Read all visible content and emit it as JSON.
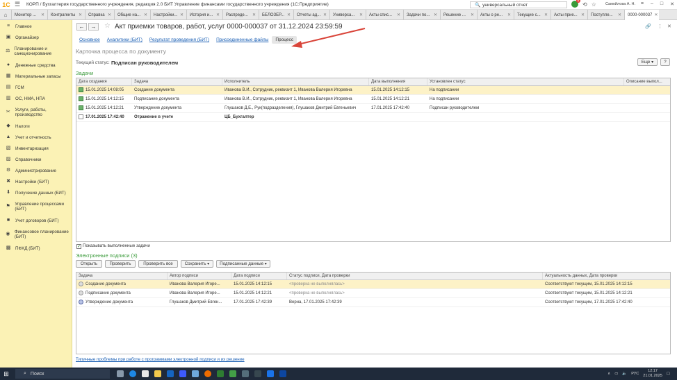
{
  "window": {
    "logo": "1С",
    "title": "КОРП / Бухгалтерия государственного учреждения, редакция 2.0 БИТ Управление финансами государственного учреждения (1С:Предприятие)",
    "search_value": "универсальный отчет",
    "user": "Самойлова А. Н."
  },
  "tabs": [
    {
      "label": "Монитор ..."
    },
    {
      "label": "Контрагенты"
    },
    {
      "label": "Справка"
    },
    {
      "label": "Общие на..."
    },
    {
      "label": "Настройки..."
    },
    {
      "label": "История и..."
    },
    {
      "label": "Распреде..."
    },
    {
      "label": "БЕЛОЗЕР..."
    },
    {
      "label": "Отчеты ад..."
    },
    {
      "label": "Универса..."
    },
    {
      "label": "Акты спис..."
    },
    {
      "label": "Задачи по..."
    },
    {
      "label": "Решение ..."
    },
    {
      "label": "Акты о ре..."
    },
    {
      "label": "Текущие с..."
    },
    {
      "label": "Акты прие..."
    },
    {
      "label": "Поступле..."
    },
    {
      "label": "0000-000037"
    }
  ],
  "sidebar": {
    "items": [
      {
        "label": "Главное",
        "icon": "menu-icon"
      },
      {
        "label": "Органайзер",
        "icon": "organizer-icon"
      },
      {
        "label": "Планирование и санкционирование",
        "icon": "planning-icon"
      },
      {
        "label": "Денежные средства",
        "icon": "money-icon"
      },
      {
        "label": "Материальные запасы",
        "icon": "materials-icon"
      },
      {
        "label": "ГСМ",
        "icon": "fuel-icon"
      },
      {
        "label": "ОС, НМА, НПА",
        "icon": "assets-icon"
      },
      {
        "label": "Услуги, работы, производство",
        "icon": "services-icon"
      },
      {
        "label": "Налоги",
        "icon": "taxes-icon"
      },
      {
        "label": "Учет и отчетность",
        "icon": "accounting-icon"
      },
      {
        "label": "Инвентаризация",
        "icon": "inventory-icon"
      },
      {
        "label": "Справочники",
        "icon": "reference-icon"
      },
      {
        "label": "Администрирование",
        "icon": "admin-icon"
      },
      {
        "label": "Настройки (БИТ)",
        "icon": "settings-icon"
      },
      {
        "label": "Получение данных (БИТ)",
        "icon": "download-icon"
      },
      {
        "label": "Управление процессами (БИТ)",
        "icon": "process-icon"
      },
      {
        "label": "Учет договоров (БИТ)",
        "icon": "contracts-icon"
      },
      {
        "label": "Финансовое планирование (БИТ)",
        "icon": "finance-icon"
      },
      {
        "label": "ПФХД (БИТ)",
        "icon": "pfhd-icon"
      }
    ]
  },
  "document": {
    "title": "Акт приемки товаров, работ, услуг 0000-000037 от 31.12.2024 23:59:59",
    "subtabs": [
      {
        "label": "Основное"
      },
      {
        "label": "Аналитики (БИТ)"
      },
      {
        "label": "Результат проведения (БИТ)"
      },
      {
        "label": "Присоединенные файлы"
      },
      {
        "label": "Процесс"
      }
    ],
    "card_title": "Карточка процесса по документу",
    "status_label": "Текущий статус:",
    "status_value": "Подписан руководителем",
    "more_button": "Еще",
    "help_button": "?"
  },
  "tasks": {
    "title": "Задачи",
    "columns": [
      "Дата создания",
      "Задача",
      "Исполнитель",
      "Дата выполнения",
      "Установлен статус",
      "Описание выпол..."
    ],
    "rows": [
      {
        "created": "15.01.2025 14:08:05",
        "task": "Создание документа",
        "executor": "Иванова В.И., Сотрудник, реквизит 1, Иванова Валерия Игоревна",
        "done": "15.01.2025 14:12:15",
        "status": "На подписании",
        "desc": ""
      },
      {
        "created": "15.01.2025 14:12:15",
        "task": "Подписание документа",
        "executor": "Иванова В.И., Сотрудник, реквизит 1, Иванова Валерия Игоревна",
        "done": "15.01.2025 14:12:21",
        "status": "На подписании",
        "desc": ""
      },
      {
        "created": "15.01.2025 14:12:21",
        "task": "Утверждение документа",
        "executor": "Глушаков Д.Е., Рук(подразделения), Глушаков Дмитрий Евгеньевич",
        "done": "17.01.2025 17:42:40",
        "status": "Подписан руководителем",
        "desc": ""
      },
      {
        "created": "17.01.2025 17:42:40",
        "task": "Отражение в учете",
        "executor": "ЦБ_Бухгалтер",
        "done": "",
        "status": "",
        "desc": ""
      }
    ],
    "show_completed_label": "Показывать выполненные задачи"
  },
  "signatures": {
    "title": "Электронные подписи (3)",
    "buttons": {
      "open": "Открыть",
      "verify": "Проверить",
      "verify_all": "Проверить все",
      "save": "Сохранить",
      "signed_data": "Подписанные данные"
    },
    "columns": [
      "Задача",
      "Автор подписи",
      "Дата подписи",
      "Статус подписи, Дата проверки",
      "Актуальность данных, Дата проверки"
    ],
    "rows": [
      {
        "task": "Создание документа",
        "author": "Иванова Валерия Игоре...",
        "date": "15.01.2025 14:12:15",
        "status": "<проверка не выполнялась>",
        "actual": "Соответствуют текущим, 15.01.2025 14:12:15"
      },
      {
        "task": "Подписание документа",
        "author": "Иванова Валерия Игоре...",
        "date": "15.01.2025 14:12:21",
        "status": "<проверка не выполнялась>",
        "actual": "Соответствуют текущим, 15.01.2025 14:12:21"
      },
      {
        "task": "Утверждение документа",
        "author": "Глушаков Дмитрий Евген...",
        "date": "17.01.2025 17:42:39",
        "status": "Верна, 17.01.2025 17:42:39",
        "actual": "Соответствуют текущим, 17.01.2025 17:42:40"
      }
    ]
  },
  "footer_link": "Типичные проблемы при работе с программами электронной подписи и их решение",
  "taskbar": {
    "search": "Поиск",
    "lang": "РУС",
    "time": "12:17",
    "date": "21.01.2025"
  },
  "colors": {
    "sidebar_bg": "#fbf2b5",
    "accent_green": "#3a9a3a",
    "link_blue": "#1a5fb4",
    "selected_row": "#fdf2c7",
    "arrow_red": "#d9453a"
  }
}
